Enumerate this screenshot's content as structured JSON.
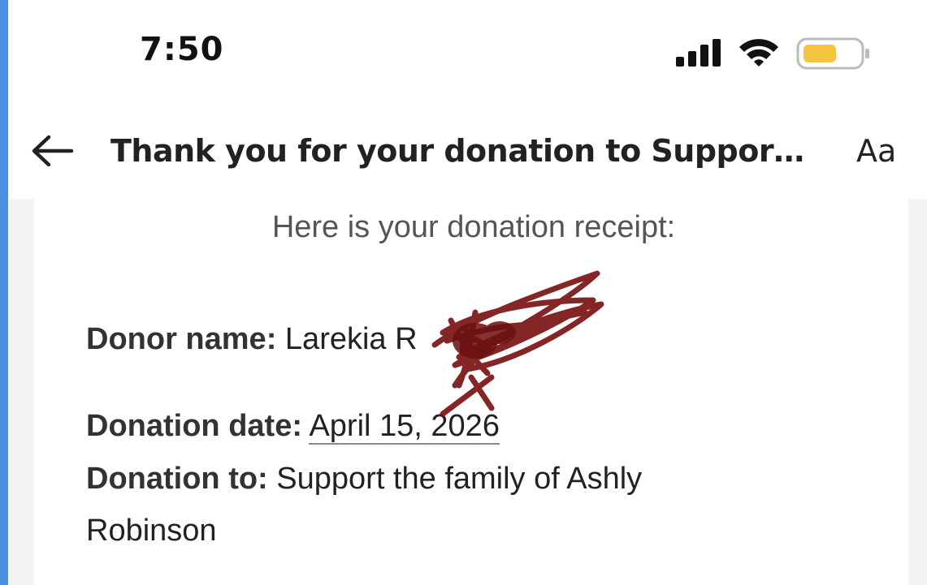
{
  "status_bar": {
    "time": "7:50"
  },
  "header": {
    "back_icon": "arrow-left-icon",
    "subject": "Thank you for your donation to Suppor…",
    "text_size_label": "Aa"
  },
  "email_body": {
    "intro": "Here is your donation receipt:",
    "donor_name": {
      "label": "Donor name:",
      "value": "Larekia R"
    },
    "donation_date": {
      "label": "Donation date:",
      "value": "April 15, 2026"
    },
    "donation_to": {
      "label": "Donation to:",
      "value_line1": "Support the family of Ashly",
      "value_line2": "Robinson"
    }
  },
  "colors": {
    "accent_edge": "#4a90e2",
    "redaction_scribble": "#7a1414",
    "battery_fill": "#f5c542"
  }
}
